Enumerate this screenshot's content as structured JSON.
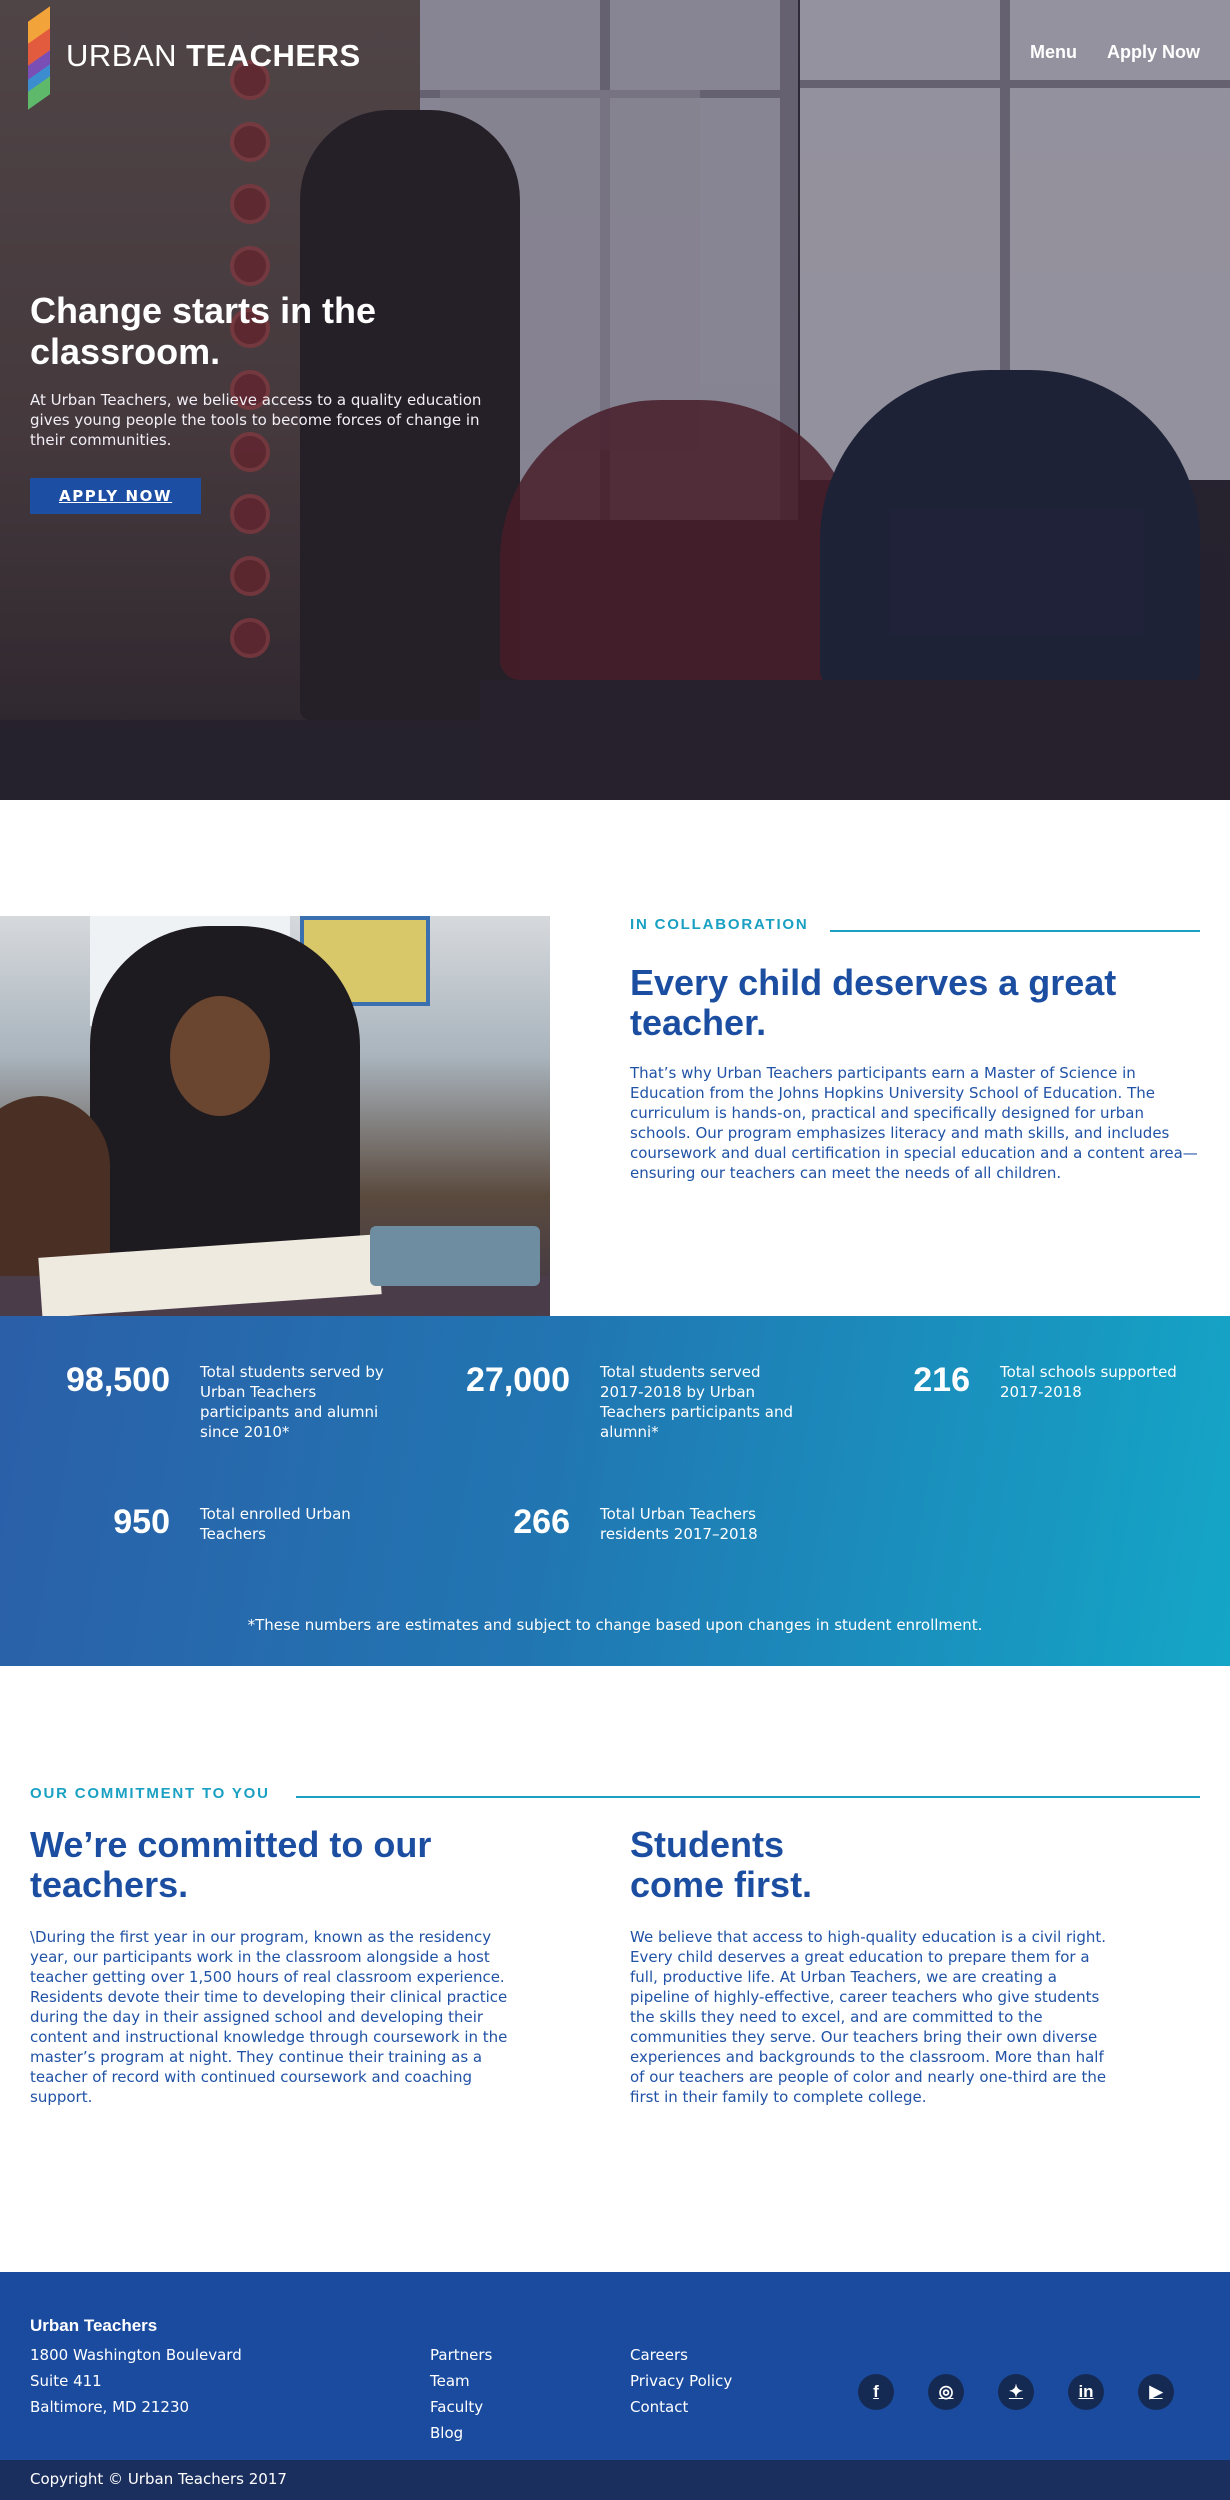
{
  "brand": {
    "name_light": "URBAN",
    "name_bold": "TEACHERS",
    "logo_colors": [
      "#f2a33a",
      "#e25b3f",
      "#7a4fb5",
      "#3c8dd0",
      "#5fb96a"
    ]
  },
  "nav": {
    "menu": "Menu",
    "apply": "Apply Now"
  },
  "hero": {
    "title": "Change starts in the classroom.",
    "body": "At Urban Teachers, we believe access to a quality education gives young people the tools to become forces of change in their communities.",
    "cta": "APPLY NOW"
  },
  "collab": {
    "label": "IN COLLABORATION",
    "title": "Every child deserves a great teacher.",
    "body": "That’s why Urban Teachers participants earn a Master of Science in Education from the Johns Hopkins University School of Education. The curriculum is hands-on, practical and specifically designed for urban schools. Our program emphasizes literacy and math skills, and includes coursework and dual certification in special education and a content area—ensuring our teachers can meet the needs of all children."
  },
  "stats": {
    "items": [
      {
        "number": "98,500",
        "text": "Total students served by Urban Teachers participants and alumni since 2010*"
      },
      {
        "number": "27,000",
        "text": "Total students served 2017-2018 by Urban Teachers participants and alumni*"
      },
      {
        "number": "216",
        "text": "Total schools supported 2017-2018"
      },
      {
        "number": "950",
        "text": "Total enrolled Urban Teachers"
      },
      {
        "number": "266",
        "text": "Total Urban Teachers residents 2017–2018"
      }
    ],
    "note": "*These numbers are estimates and subject to change based upon changes in student enrollment."
  },
  "commitment": {
    "label": "OUR COMMITMENT TO YOU",
    "left_title": "We’re committed to our teachers.",
    "left_body": "\\During the first year in our program, known as the residency year, our participants work in the classroom alongside a host teacher getting over 1,500 hours of real classroom experience. Residents devote their time to developing their clinical practice during the day in their assigned school and developing their content and instructional knowledge through coursework in the master’s program at night. They continue their training as a teacher of record with continued coursework and coaching support.",
    "right_title_line1": "Students",
    "right_title_line2": "come first.",
    "right_body": "We believe that access to high-quality education is a civil right. Every child deserves a great education to prepare them for a full, productive life. At Urban Teachers, we are creating a pipeline of highly-effective, career teachers who give students the skills they need to excel, and are committed to the communities they serve. Our teachers bring their own diverse experiences and backgrounds to the classroom. More than half of our teachers are people of color and nearly one-third are the first in their family to complete college."
  },
  "footer": {
    "org": "Urban Teachers",
    "address": [
      "1800 Washington Boulevard",
      "Suite 411",
      "Baltimore, MD 21230"
    ],
    "links_col1": [
      "Partners",
      "Team",
      "Faculty",
      "Blog"
    ],
    "links_col2": [
      "Careers",
      "Privacy Policy",
      "Contact"
    ],
    "social": [
      {
        "icon": "facebook-icon",
        "glyph": "f"
      },
      {
        "icon": "instagram-icon",
        "glyph": "◎"
      },
      {
        "icon": "twitter-icon",
        "glyph": "✦"
      },
      {
        "icon": "linkedin-icon",
        "glyph": "in"
      },
      {
        "icon": "youtube-icon",
        "glyph": "▶"
      }
    ],
    "copyright": "Copyright © Urban Teachers 2017"
  }
}
